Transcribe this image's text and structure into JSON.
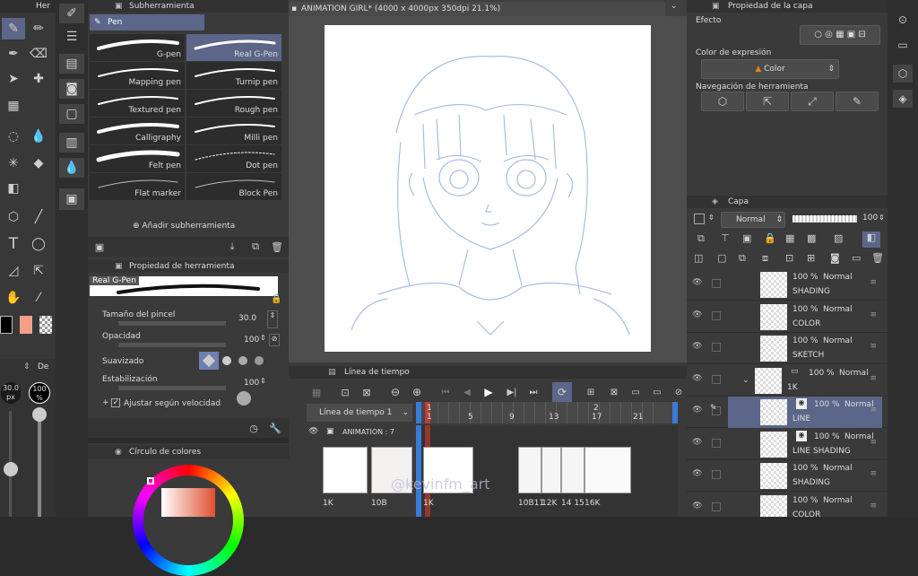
{
  "tools_panel": {
    "tab_label": "Her"
  },
  "subtool_panel": {
    "title": "Subherramienta",
    "group_label": "Pen",
    "brushes": [
      {
        "label": "G-pen"
      },
      {
        "label": "Real G-Pen"
      },
      {
        "label": "Mapping pen"
      },
      {
        "label": "Turnip pen"
      },
      {
        "label": "Textured pen"
      },
      {
        "label": "Rough pen"
      },
      {
        "label": "Calligraphy"
      },
      {
        "label": "Milli pen"
      },
      {
        "label": "Felt pen"
      },
      {
        "label": "Dot pen"
      },
      {
        "label": "Flat marker"
      },
      {
        "label": "Block Pen"
      }
    ],
    "add_label": "Añadir subherramienta"
  },
  "tool_property": {
    "title": "Propiedad de herramienta",
    "current_tool": "Real G-Pen",
    "brush_size_label": "Tamaño del pincel",
    "brush_size_value": "30.0",
    "opacity_label": "Opacidad",
    "opacity_value": "100",
    "smoothing_label": "Suavizado",
    "stabilization_label": "Estabilización",
    "stabilization_value": "100",
    "speed_label": "Ajustar según velocidad"
  },
  "size_slider": {
    "value": "30.0",
    "unit": "px",
    "opacity_value": "100",
    "opacity_unit": "%",
    "tab_label": "De"
  },
  "color_wheel": {
    "title": "Círculo de colores"
  },
  "canvas": {
    "tab_title": "ANIMATION GIRL* (4000 x 4000px 350dpi 21.1%)"
  },
  "timeline": {
    "title": "Línea de tiempo",
    "name": "Línea de tiempo 1",
    "frame_numbers": [
      "1",
      "5",
      "9",
      "13",
      "17",
      "21"
    ],
    "frame_numbers_top": [
      "1",
      "2"
    ],
    "track_label": "ANIMATION : 7",
    "cels": [
      {
        "label": "1K"
      },
      {
        "label": "10B"
      },
      {
        "label": "1K"
      },
      {
        "label": "10B11"
      },
      {
        "label": "12K"
      },
      {
        "label": "14 15"
      },
      {
        "label": "16K"
      }
    ]
  },
  "watermark": "@kevinfm_art",
  "layer_property": {
    "title": "Propiedad de la capa",
    "effect_label": "Efecto",
    "expression_label": "Color de expresión",
    "expression_value": "Color",
    "nav_label": "Navegación de herramienta"
  },
  "layers_panel": {
    "title": "Capa",
    "blend_mode": "Normal",
    "opacity": "100",
    "layers": [
      {
        "percent": "100 %",
        "mode": "Normal",
        "name": "SHADING"
      },
      {
        "percent": "100 %",
        "mode": "Normal",
        "name": "COLOR"
      },
      {
        "percent": "100 %",
        "mode": "Normal",
        "name": "SKETCH"
      },
      {
        "percent": "100 %",
        "mode": "Normal",
        "name": "1K"
      },
      {
        "percent": "100 %",
        "mode": "Normal",
        "name": "LINE"
      },
      {
        "percent": "100 %",
        "mode": "Normal",
        "name": "LINE SHADING"
      },
      {
        "percent": "100 %",
        "mode": "Normal",
        "name": "SHADING"
      },
      {
        "percent": "100 %",
        "mode": "Normal",
        "name": "COLOR"
      }
    ]
  },
  "colors": {
    "accent": "#5b6688",
    "main_color": "#000000",
    "sub_color": "#f4a088",
    "keyframe": "#c0392b",
    "timeline_blue": "#3a7bd5"
  }
}
